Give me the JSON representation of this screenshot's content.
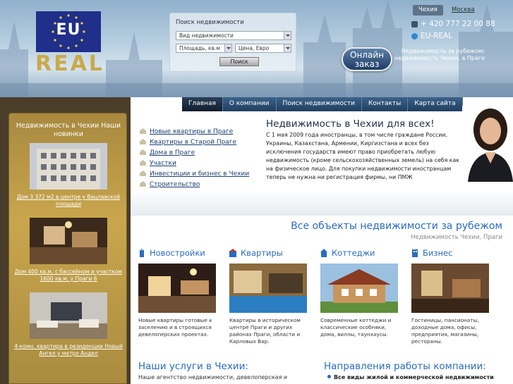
{
  "header": {
    "logo_top": "EU",
    "logo_bottom": "REAL",
    "search": {
      "title": "Поиск недвижимости",
      "type_value": "Вид недвижимости",
      "area_value": "Площадь, кв.м",
      "price_value": "Цена, Евро",
      "button": "Поиск"
    },
    "lang_cz": "Чехия",
    "lang_msk": "Москва",
    "phone": "+ 420 777 22 00 88",
    "skype": "EU-REAL",
    "order_button": "Онлайн заказ",
    "tagline": "Недвижимость за рубежом: недвижимость Чехии, в Праге"
  },
  "nav": {
    "items": [
      "Главная",
      "О компании",
      "Поиск недвижимости",
      "Контакты",
      "Карта сайта"
    ]
  },
  "left": {
    "title": "Недвижимость в Чехии Наши новинки",
    "listings": [
      {
        "caption": "Дом 3 372 м2 в центре у Вацлавской площади"
      },
      {
        "caption": "Дом 400 кв.м. с бассейном и участком 1600 кв.м. у Праги 6"
      },
      {
        "caption": "4-комн. квартира в резиденции Новый Ангел у метро Андел"
      }
    ]
  },
  "links": [
    "Новые квартиры в Праге",
    "Квартиры в Старой Праге",
    "Дома в Праге",
    "Участки",
    "Инвестиции и бизнес в Чехии",
    "Строительство"
  ],
  "promo": {
    "title": "Недвижимость в Чехии для всех!",
    "text": "С 1 мая 2009 года иностранцы, в том числе граждане России, Украины, Казахстана, Армении, Киргизстана и всех без исключения государств имеют право приобретать любую недвижимость (кроме сельскохозяйственных земель) на себя как на физическое лицо. Для покупки недвижимости иностранцам теперь не нужна ни регистрация фирмы, ни ПМЖ"
  },
  "section": {
    "title": "Все объекты недвижимости за рубежом",
    "subtitle": "Недвижимость Чехии, Праги"
  },
  "categories": [
    {
      "title": "Новостройки",
      "desc": "Новые квартиры готовые к заселению и в строящихся девелоперских проектах."
    },
    {
      "title": "Квартиры",
      "desc": "Квартиры в историческом центре Праги и других районах Праги, области и Карловых Вар."
    },
    {
      "title": "Коттеджи",
      "desc": "Современные коттеджи и классические особняки, дома, виллы, таунхаусы."
    },
    {
      "title": "Бизнес",
      "desc": "Гостиницы, пансионаты, доходные дома, офисы, предприятия, магазины, рестораны."
    }
  ],
  "services": {
    "title": "Наши услуги в Чехии:",
    "text": "Наше агентство недвижимости, девелоперская и"
  },
  "directions": {
    "title": "Направления работы компании:",
    "text": "Все виды жилой и коммерческой недвижимости"
  }
}
